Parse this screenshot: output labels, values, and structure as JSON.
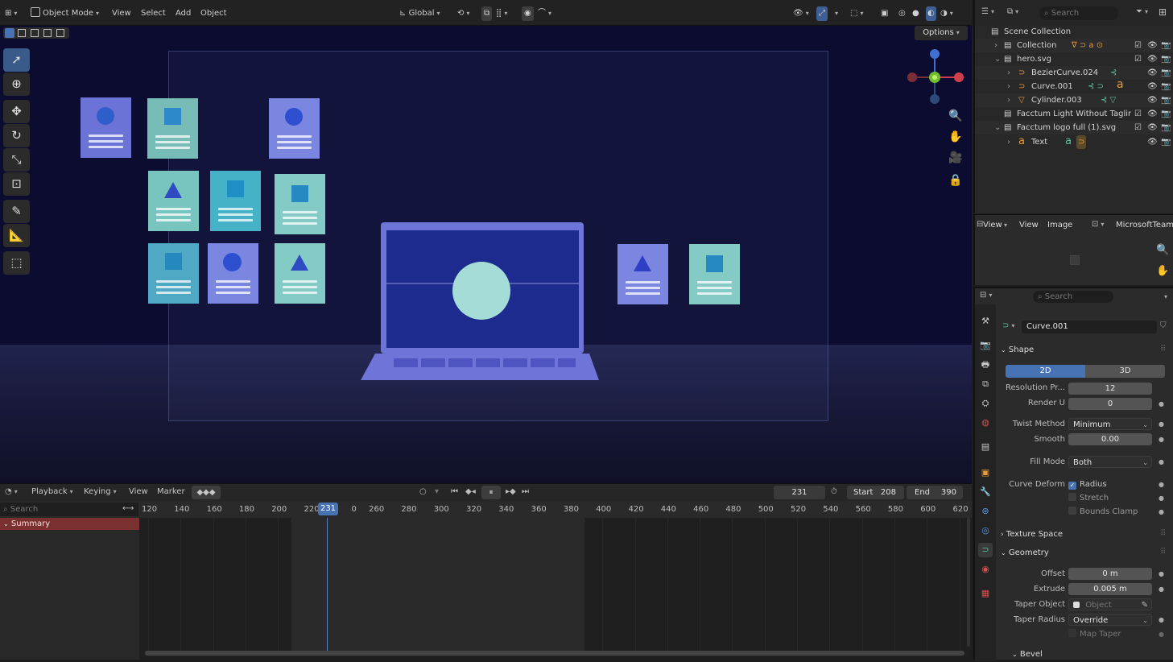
{
  "viewport_header": {
    "mode": "Object Mode",
    "menus": [
      "View",
      "Select",
      "Add",
      "Object"
    ],
    "orientation": "Global",
    "options_label": "Options"
  },
  "outliner": {
    "search_placeholder": "Search",
    "root": "Scene Collection",
    "rows": [
      {
        "label": "Collection",
        "indent": 1
      },
      {
        "label": "hero.svg",
        "indent": 1
      },
      {
        "label": "BezierCurve.024",
        "indent": 2
      },
      {
        "label": "Curve.001",
        "indent": 2
      },
      {
        "label": "Cylinder.003",
        "indent": 2
      },
      {
        "label": "Facctum Light Without Tagline",
        "indent": 1
      },
      {
        "label": "Facctum logo full (1).svg",
        "indent": 1
      },
      {
        "label": "Text",
        "indent": 2
      }
    ]
  },
  "image_editor": {
    "menus": [
      "View",
      "View",
      "Image"
    ],
    "image_name": "MicrosoftTeams"
  },
  "properties": {
    "search_placeholder": "Search",
    "object_name": "Curve.001",
    "shape_section": "Shape",
    "dim_2d": "2D",
    "dim_3d": "3D",
    "resolution_label": "Resolution Pr...",
    "resolution_value": "12",
    "render_u_label": "Render U",
    "render_u_value": "0",
    "twist_method_label": "Twist Method",
    "twist_method_value": "Minimum",
    "smooth_label": "Smooth",
    "smooth_value": "0.00",
    "fill_mode_label": "Fill Mode",
    "fill_mode_value": "Both",
    "curve_deform_label": "Curve Deform",
    "radius_label": "Radius",
    "stretch_label": "Stretch",
    "bounds_clamp_label": "Bounds Clamp",
    "texture_space_section": "Texture Space",
    "geometry_section": "Geometry",
    "offset_label": "Offset",
    "offset_value": "0 m",
    "extrude_label": "Extrude",
    "extrude_value": "0.005 m",
    "taper_object_label": "Taper Object",
    "taper_object_placeholder": "Object",
    "taper_radius_label": "Taper Radius",
    "taper_radius_value": "Override",
    "map_taper_label": "Map Taper",
    "bevel_section": "Bevel"
  },
  "timeline": {
    "menus": [
      "Playback",
      "Keying",
      "View",
      "Marker"
    ],
    "current_frame": "231",
    "start_label": "Start",
    "start_value": "208",
    "end_label": "End",
    "end_value": "390",
    "search_placeholder": "Search",
    "ticks": [
      "120",
      "140",
      "160",
      "180",
      "200",
      "220",
      "240",
      "260",
      "280",
      "300",
      "320",
      "340",
      "360",
      "380",
      "400",
      "420",
      "440",
      "460",
      "480",
      "500",
      "520",
      "540",
      "560",
      "580",
      "600",
      "620"
    ],
    "summary_label": "Summary"
  },
  "colors": {
    "viewport_bg": "#0c0c30",
    "accent_blue": "#4772b3",
    "card_purple": "#7b86e0",
    "card_teal": "#84cbc6",
    "laptop_body": "#6e74d8",
    "laptop_screen": "#1e2b8e",
    "circle_mint": "#a6dcd8"
  }
}
